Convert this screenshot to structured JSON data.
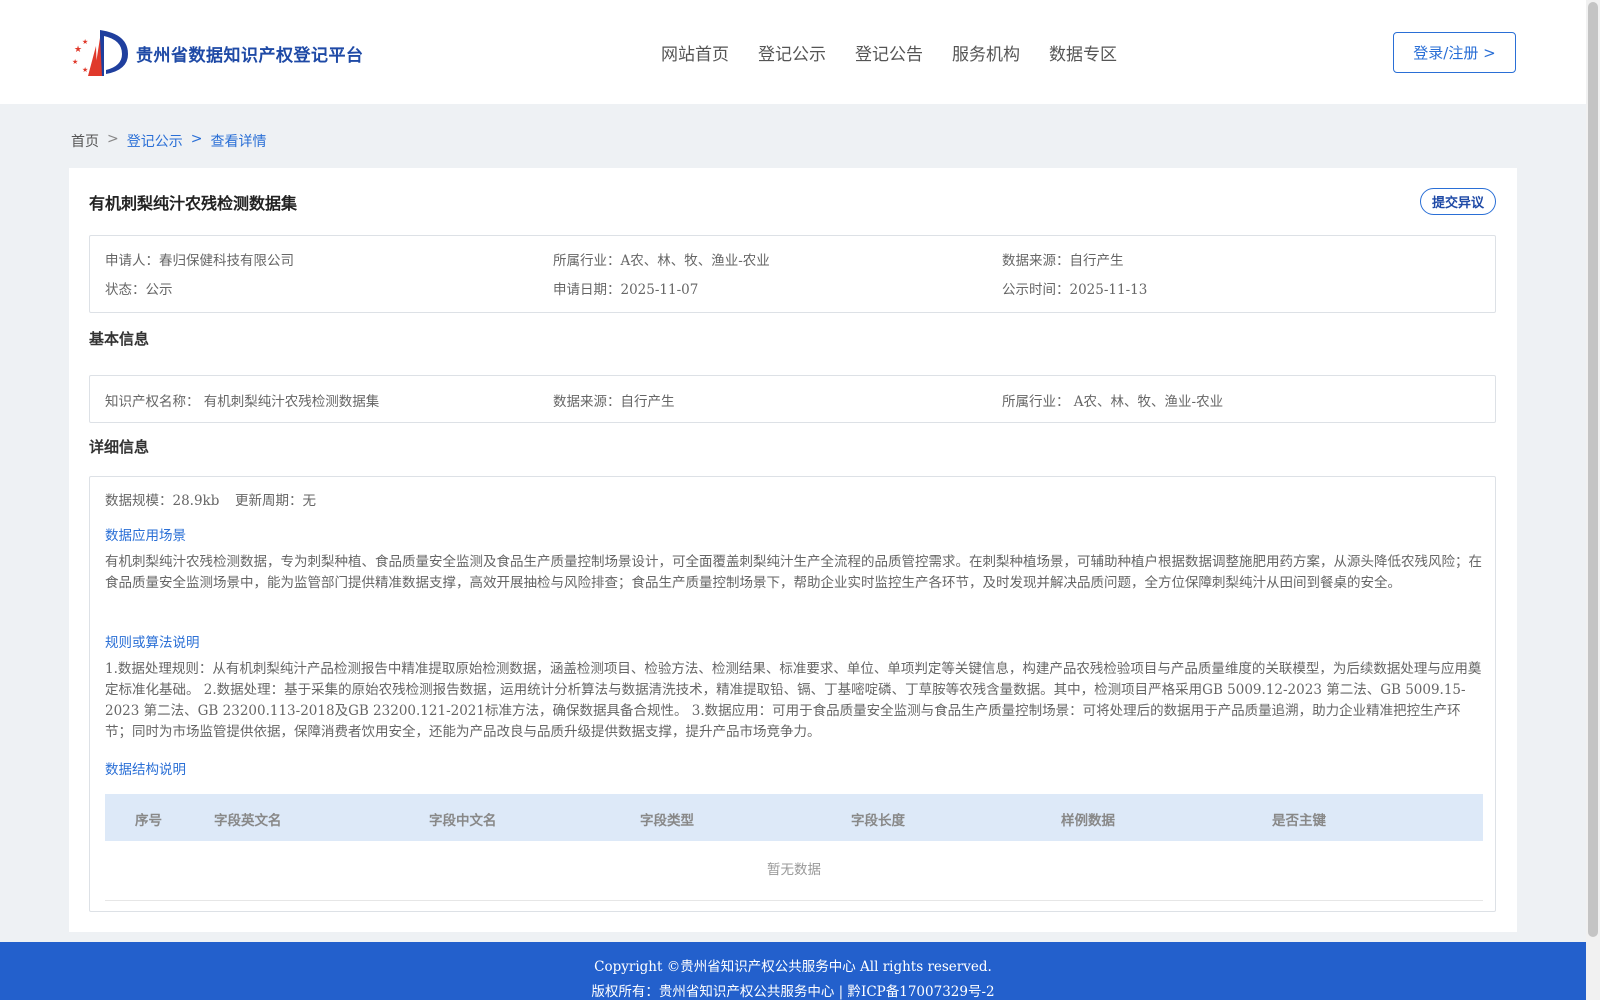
{
  "header": {
    "logo_text": "贵州省数据知识产权登记平台",
    "nav": [
      "网站首页",
      "登记公示",
      "登记公告",
      "服务机构",
      "数据专区"
    ],
    "login_label": "登录/注册 >"
  },
  "breadcrumb": [
    "首页",
    "登记公示",
    "查看详情"
  ],
  "record": {
    "title": "有机刺梨纯汁农残检测数据集",
    "objection_label": "提交异议",
    "applicant_label": "申请人：",
    "applicant": "春归保健科技有限公司",
    "industry_label": "所属行业：",
    "industry": "A农、林、牧、渔业-农业",
    "source_label": "数据来源：",
    "source": "自行产生",
    "status_label": "状态：",
    "status": "公示",
    "apply_date_label": "申请日期：",
    "apply_date": "2025-11-07",
    "publish_label": "公示时间：",
    "publish_date": "2025-11-13"
  },
  "basic": {
    "heading": "基本信息",
    "ip_name_label": "知识产权名称：",
    "ip_name": "有机刺梨纯汁农残检测数据集",
    "source_label": "数据来源：",
    "source": "自行产生",
    "industry_label": "所属行业：",
    "industry": "A农、林、牧、渔业-农业"
  },
  "detail": {
    "heading": "详细信息",
    "scale_label": "数据规模：",
    "scale": "28.9kb",
    "cycle_label": "更新周期：",
    "cycle": "无",
    "scenario_title": "数据应用场景",
    "scenario_text": "有机刺梨纯汁农残检测数据，专为刺梨种植、食品质量安全监测及食品生产质量控制场景设计，可全面覆盖刺梨纯汁生产全流程的品质管控需求。在刺梨种植场景，可辅助种植户根据数据调整施肥用药方案，从源头降低农残风险；在食品质量安全监测场景中，能为监管部门提供精准数据支撑，高效开展抽检与风险排查；食品生产质量控制场景下，帮助企业实时监控生产各环节，及时发现并解决品质问题，全方位保障刺梨纯汁从田间到餐桌的安全。",
    "rule_title": "规则或算法说明",
    "rule_text": "1.数据处理规则：从有机刺梨纯汁产品检测报告中精准提取原始检测数据，涵盖检测项目、检验方法、检测结果、标准要求、单位、单项判定等关键信息，构建产品农残检验项目与产品质量维度的关联模型，为后续数据处理与应用奠定标准化基础。 2.数据处理：基于采集的原始农残检测报告数据，运用统计分析算法与数据清洗技术，精准提取铅、镉、丁基嘧啶磷、丁草胺等农残含量数据。其中，检测项目严格采用GB 5009.12-2023 第二法、GB 5009.15-2023 第二法、GB 23200.113-2018及GB 23200.121-2021标准方法，确保数据具备合规性。 3.数据应用：可用于食品质量安全监测与食品生产质量控制场景：可将处理后的数据用于产品质量追溯，助力企业精准把控生产环节；同时为市场监管提供依据，保障消费者饮用安全，还能为产品改良与品质升级提供数据支撑，提升产品市场竞争力。",
    "structure_title": "数据结构说明",
    "columns": [
      "序号",
      "字段英文名",
      "字段中文名",
      "字段类型",
      "字段长度",
      "样例数据",
      "是否主键"
    ],
    "empty_text": "暂无数据"
  },
  "footer": {
    "copyright": "Copyright ©贵州省知识产权公共服务中心 All rights reserved.",
    "owner": "版权所有：贵州省知识产权公共服务中心 | 黔ICP备17007329号-2"
  },
  "colors": {
    "brand_blue": "#2a6fd6",
    "footer_blue": "#2360cc",
    "table_head": "#dde9f8"
  }
}
